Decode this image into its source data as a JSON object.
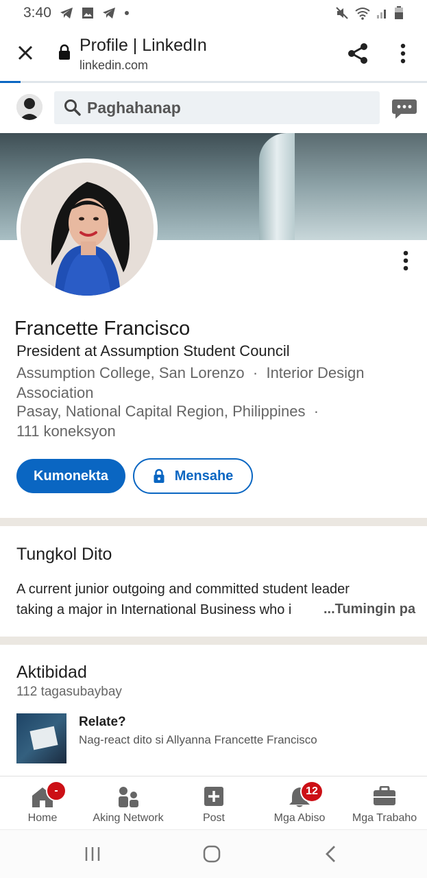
{
  "status_bar": {
    "time": "3:40"
  },
  "browser": {
    "page_title": "Profile | LinkedIn",
    "url": "linkedin.com"
  },
  "search": {
    "placeholder": "Paghahanap"
  },
  "profile": {
    "name": "Francette Francisco",
    "headline": "President at Assumption Student Council",
    "education": "Assumption College, San Lorenzo",
    "organization": "Interior Design Association",
    "separator": "·",
    "location": "Pasay, National Capital Region, Philippines",
    "connections": "111 koneksyon",
    "connect_label": "Kumonekta",
    "message_label": "Mensahe"
  },
  "about": {
    "title": "Tungkol Dito",
    "line1": "A current junior outgoing and committed student leader",
    "line2": "taking a major in International Business who i",
    "see_more": "...Tumingin pa"
  },
  "activity": {
    "title": "Aktibidad",
    "followers": "112 tagasubaybay",
    "post_title": "Relate?",
    "post_subtitle": "Nag-react dito si Allyanna Francette Francisco"
  },
  "bottom_nav": {
    "items": [
      {
        "label": "Home",
        "icon": "home-icon",
        "badge": "-"
      },
      {
        "label": "Aking Network",
        "icon": "network-icon"
      },
      {
        "label": "Post",
        "icon": "post-icon"
      },
      {
        "label": "Mga Abiso",
        "icon": "bell-icon",
        "badge": "12"
      },
      {
        "label": "Mga Trabaho",
        "icon": "briefcase-icon"
      }
    ]
  },
  "colors": {
    "brand": "#0a66c2",
    "badge": "#cc1016",
    "divider": "#ebe7e1"
  }
}
